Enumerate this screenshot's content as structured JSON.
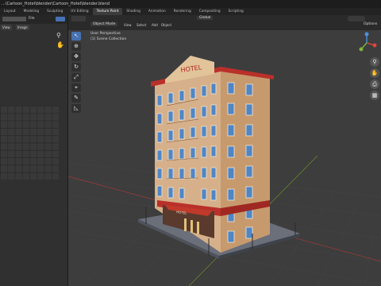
{
  "titlebar": {
    "path": "...\\Cartoon_Hotel\\blender\\Cartoon_Hotel\\blender.blend"
  },
  "tabs": [
    {
      "label": "Layout"
    },
    {
      "label": "Modeling"
    },
    {
      "label": "Sculpting"
    },
    {
      "label": "UV Editing"
    },
    {
      "label": "Texture Paint"
    },
    {
      "label": "Shading"
    },
    {
      "label": "Animation"
    },
    {
      "label": "Rendering"
    },
    {
      "label": "Compositing"
    },
    {
      "label": "Scripting"
    }
  ],
  "left_panel": {
    "view_label": "View",
    "image_label": "Image",
    "file_label": "File"
  },
  "viewport": {
    "mode_label": "Object Mode",
    "menus": [
      "View",
      "Select",
      "Add",
      "Object"
    ],
    "global_label": "Global",
    "options_label": "Options",
    "info_line1": "User Perspective",
    "info_line2": "(1) Scene Collection",
    "sign_text": "HOTEL"
  },
  "colors": {
    "accent": "#4772b3",
    "x_axis": "#9b3a3a",
    "y_axis": "#6b8e2b",
    "wall": "#d8b48e",
    "roof": "#c0392b"
  },
  "icons": [
    "select-box-icon",
    "cursor-icon",
    "move-icon",
    "rotate-icon",
    "scale-icon",
    "transform-icon",
    "annotate-icon",
    "measure-icon",
    "zoom-icon",
    "hand-icon",
    "gizmo-icon",
    "camera-icon",
    "grid-icon"
  ]
}
